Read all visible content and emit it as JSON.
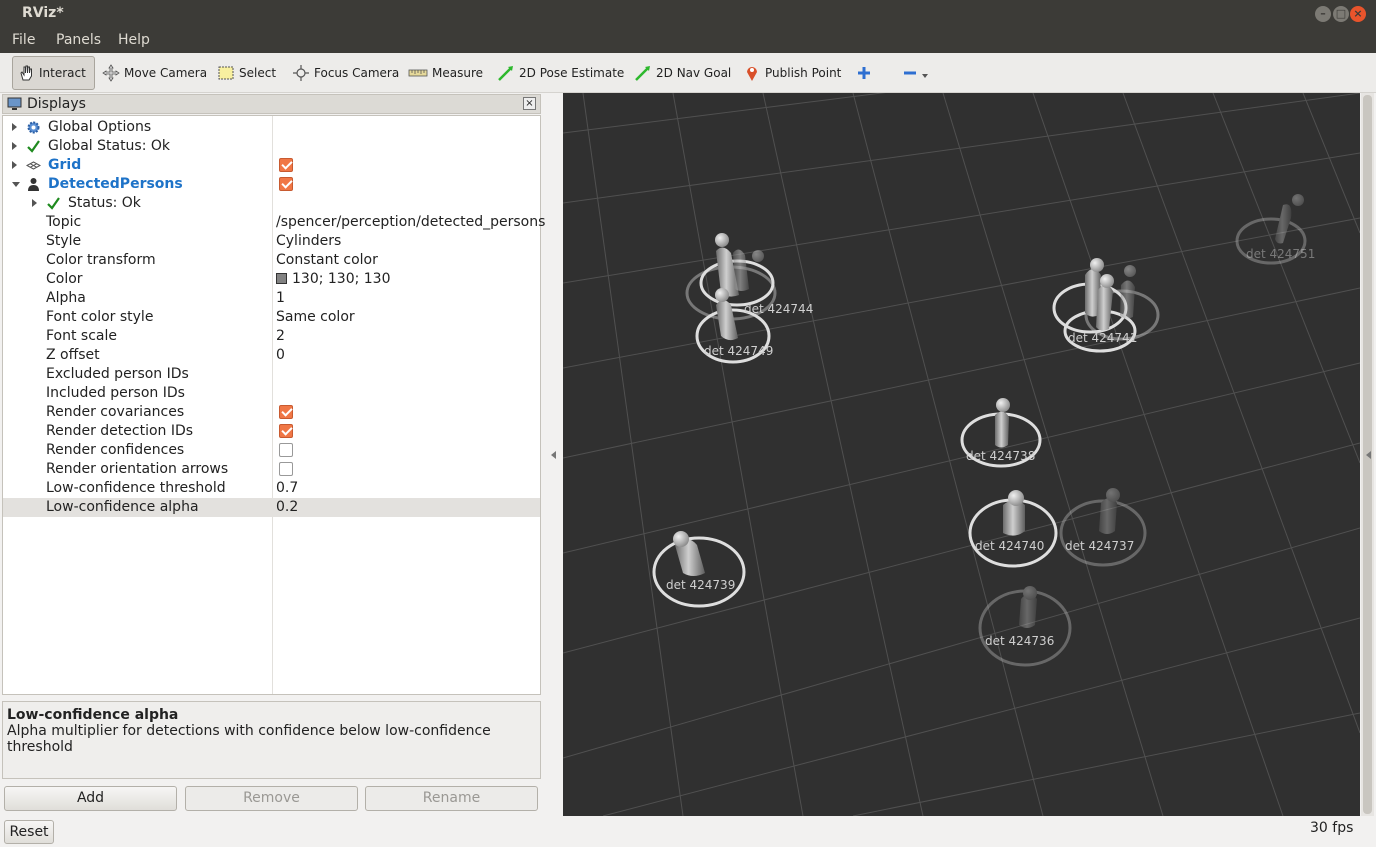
{
  "window": {
    "title": "RViz*"
  },
  "menu": [
    "File",
    "Panels",
    "Help"
  ],
  "toolbar": {
    "interact": "Interact",
    "move_camera": "Move Camera",
    "select": "Select",
    "focus_camera": "Focus Camera",
    "measure": "Measure",
    "pose_estimate": "2D Pose Estimate",
    "nav_goal": "2D Nav Goal",
    "publish_point": "Publish Point"
  },
  "displays": {
    "title": "Displays",
    "global_options": "Global Options",
    "global_status": "Global Status: Ok",
    "grid": "Grid",
    "detected_persons": "DetectedPersons",
    "status": "Status: Ok",
    "properties": [
      {
        "key": "Topic",
        "value": "/spencer/perception/detected_persons"
      },
      {
        "key": "Style",
        "value": "Cylinders"
      },
      {
        "key": "Color transform",
        "value": "Constant color"
      },
      {
        "key": "Color",
        "value": "130; 130; 130"
      },
      {
        "key": "Alpha",
        "value": "1"
      },
      {
        "key": "Font color style",
        "value": "Same color"
      },
      {
        "key": "Font scale",
        "value": "2"
      },
      {
        "key": "Z offset",
        "value": "0"
      },
      {
        "key": "Excluded person IDs",
        "value": ""
      },
      {
        "key": "Included person IDs",
        "value": ""
      },
      {
        "key": "Render covariances",
        "value": ""
      },
      {
        "key": "Render detection IDs",
        "value": ""
      },
      {
        "key": "Render confidences",
        "value": ""
      },
      {
        "key": "Render orientation arrows",
        "value": ""
      },
      {
        "key": "Low-confidence threshold",
        "value": "0.7"
      },
      {
        "key": "Low-confidence alpha",
        "value": "0.2"
      }
    ]
  },
  "description": {
    "title": "Low-confidence alpha",
    "text": "Alpha multiplier for detections with confidence below low-confidence threshold"
  },
  "buttons": {
    "add": "Add",
    "remove": "Remove",
    "rename": "Rename",
    "reset": "Reset"
  },
  "status": {
    "fps": "30 fps"
  },
  "detections": [
    {
      "label": "det 424751"
    },
    {
      "label": "det 424744"
    },
    {
      "label": "det 424749"
    },
    {
      "label": "det 424741"
    },
    {
      "label": "det 424738"
    },
    {
      "label": "det 424740"
    },
    {
      "label": "det 424737"
    },
    {
      "label": "det 424739"
    },
    {
      "label": "det 424736"
    }
  ]
}
